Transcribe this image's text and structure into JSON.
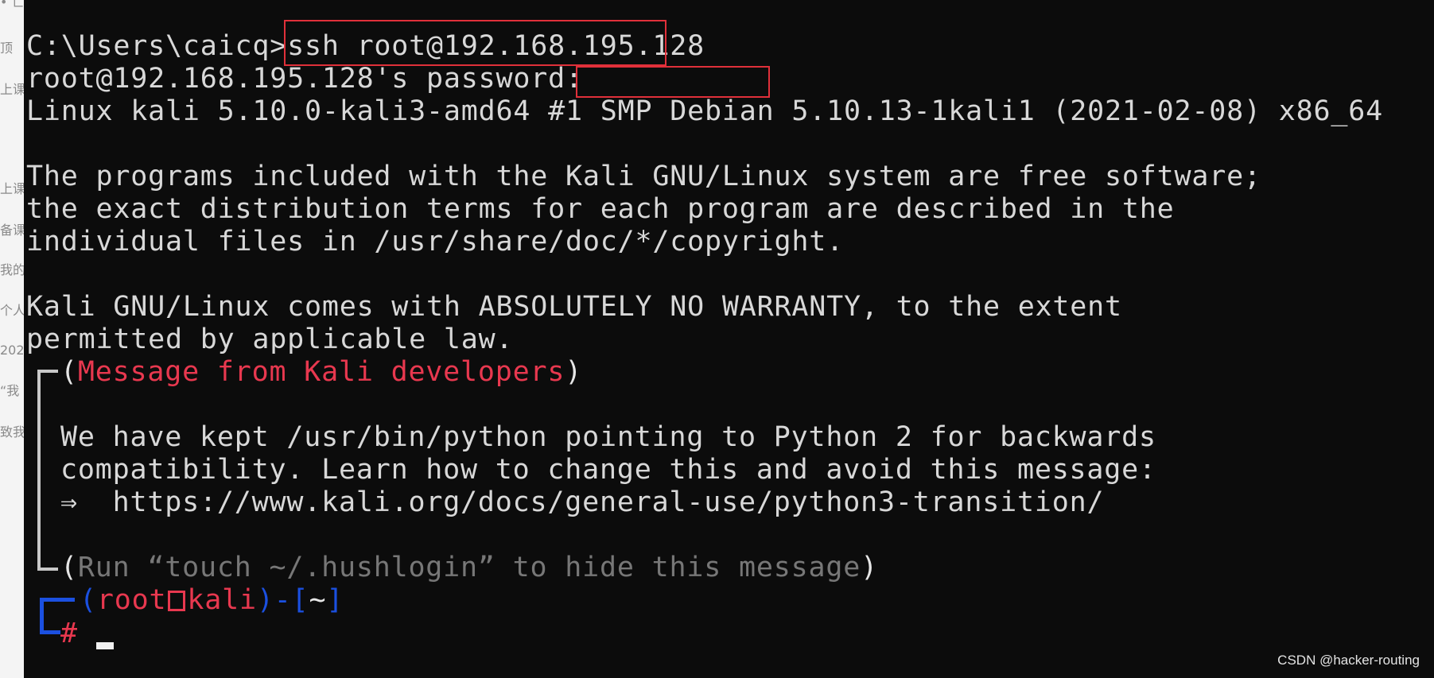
{
  "background_page": {
    "fragments": [
      "• 亡",
      "顶",
      "上课",
      "上课",
      "备课",
      "我的",
      "个人",
      "202",
      "“我",
      "致我"
    ]
  },
  "terminal": {
    "cmd_prompt": "C:\\Users\\caicq>",
    "ssh_command": "ssh root@192.168.195.128",
    "password_prompt": "root@192.168.195.128's password",
    "password_colon": ":",
    "uname": "Linux kali 5.10.0-kali3-amd64 #1 SMP Debian 5.10.13-1kali1 (2021-02-08) x86_64",
    "free_1": "The programs included with the Kali GNU/Linux system are free software;",
    "free_2": "the exact distribution terms for each program are described in the",
    "free_3": "individual files in /usr/share/doc/*/copyright.",
    "warranty_1": "Kali GNU/Linux comes with ABSOLUTELY NO WARRANTY, to the extent",
    "warranty_2": "permitted by applicable law.",
    "msg_open": "(",
    "msg_title": "Message from Kali developers",
    "msg_close": ")",
    "msg_1": "We have kept /usr/bin/python pointing to Python 2 for backwards",
    "msg_2": "compatibility. Learn how to change this and avoid this message:",
    "msg_arrow": "⇒",
    "msg_url": "https://www.kali.org/docs/general-use/python3-transition/",
    "hush_open": "(",
    "hush_text": "Run “touch ~/.hushlogin” to hide this message",
    "hush_close": ")",
    "prompt_paren_open": "(",
    "prompt_user": "root",
    "prompt_host": "kali",
    "prompt_paren_close": ")",
    "prompt_dash": "-",
    "prompt_dir_open": "[",
    "prompt_dir": "~",
    "prompt_dir_close": "]",
    "prompt_hash": "#"
  },
  "watermark": "CSDN @hacker-routing",
  "colors": {
    "background": "#0c0c0c",
    "text": "#d8d8d8",
    "kali_red": "#e8384f",
    "kali_blue": "#1b50e0",
    "annotation_box": "#e0303a"
  }
}
